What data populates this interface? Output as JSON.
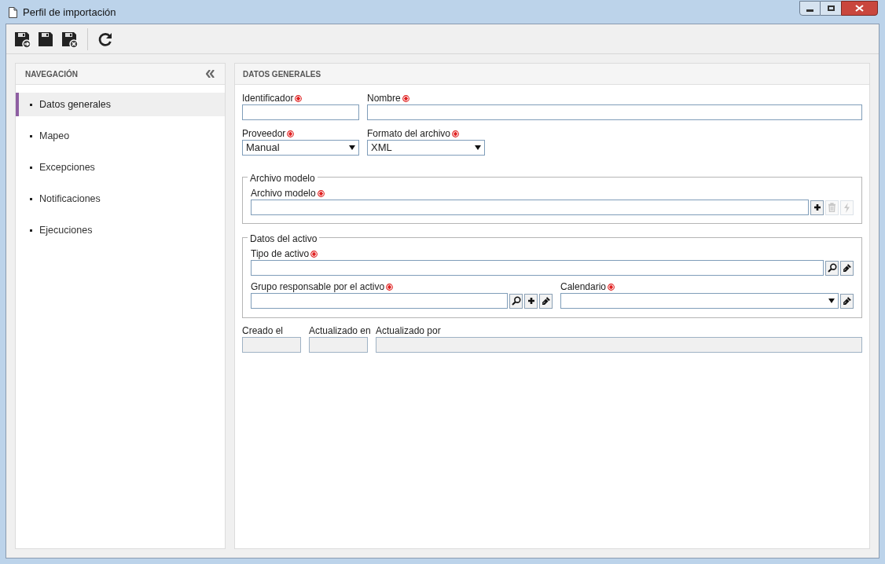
{
  "window": {
    "title": "Perfil de importación"
  },
  "navigation": {
    "title": "NAVEGACIÓN",
    "items": [
      {
        "label": "Datos generales",
        "selected": true
      },
      {
        "label": "Mapeo",
        "selected": false
      },
      {
        "label": "Excepciones",
        "selected": false
      },
      {
        "label": "Notificaciones",
        "selected": false
      },
      {
        "label": "Ejecuciones",
        "selected": false
      }
    ]
  },
  "section": {
    "title": "DATOS GENERALES",
    "row_1": [
      {
        "label": "Identificador",
        "required": true
      },
      {
        "label": "Nombre",
        "required": true
      }
    ],
    "row_2": [
      {
        "label": "Proveedor",
        "required": true,
        "kind": "select",
        "value": "Manual"
      },
      {
        "label": "Formato del archivo",
        "required": true,
        "kind": "select",
        "value": "XML"
      }
    ],
    "archivo_modelo": {
      "legend": "Archivo modelo",
      "field": {
        "label": "Archivo modelo",
        "required": true
      },
      "buttons": [
        {
          "kind": "add",
          "disabled": false
        },
        {
          "kind": "delete",
          "disabled": true
        },
        {
          "kind": "execute",
          "disabled": true
        }
      ]
    },
    "datos_del_activo": {
      "legend": "Datos del activo",
      "tipo": {
        "label": "Tipo de activo",
        "required": true,
        "buttons": [
          {
            "kind": "search",
            "disabled": false
          },
          {
            "kind": "clear",
            "disabled": false
          }
        ]
      },
      "grupo": {
        "label": "Grupo responsable por el activo",
        "required": true,
        "buttons": [
          {
            "kind": "search",
            "disabled": false
          },
          {
            "kind": "add",
            "disabled": false
          },
          {
            "kind": "clear",
            "disabled": false
          }
        ]
      },
      "calendario": {
        "label": "Calendario",
        "required": true,
        "kind": "select",
        "buttons": [
          {
            "kind": "clear",
            "disabled": false
          }
        ]
      }
    },
    "audit": [
      {
        "label": "Creado el",
        "disabled": true
      },
      {
        "label": "Actualizado en",
        "disabled": true
      },
      {
        "label": "Actualizado por",
        "disabled": true
      }
    ]
  }
}
